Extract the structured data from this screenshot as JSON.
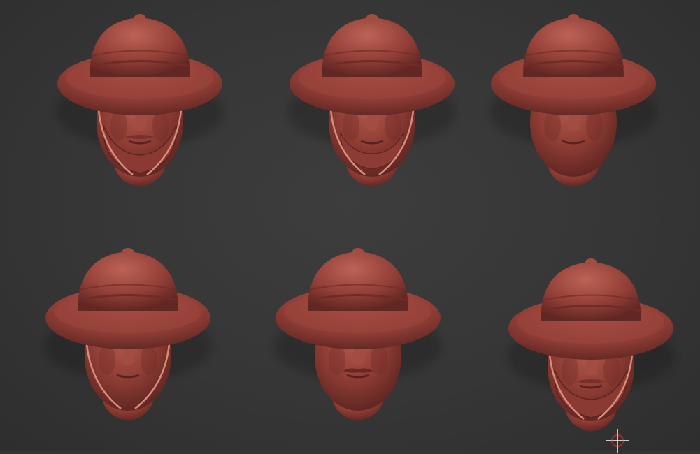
{
  "viewport": {
    "background": "#343434",
    "model_color": "#8a3a32"
  },
  "heads": [
    {
      "hat": "pith-helmet",
      "face": "full-beard",
      "chin_strap": true
    },
    {
      "hat": "pith-helmet",
      "face": "short-beard",
      "chin_strap": true
    },
    {
      "hat": "pith-helmet",
      "face": "clean-shaven",
      "chin_strap": false
    },
    {
      "hat": "pith-helmet",
      "face": "clean-shaven",
      "chin_strap": true
    },
    {
      "hat": "pith-helmet",
      "face": "moustache",
      "chin_strap": false
    },
    {
      "hat": "pith-helmet",
      "face": "full-beard",
      "chin_strap": true
    }
  ],
  "cursor": {
    "icon": "crosshair-icon"
  }
}
